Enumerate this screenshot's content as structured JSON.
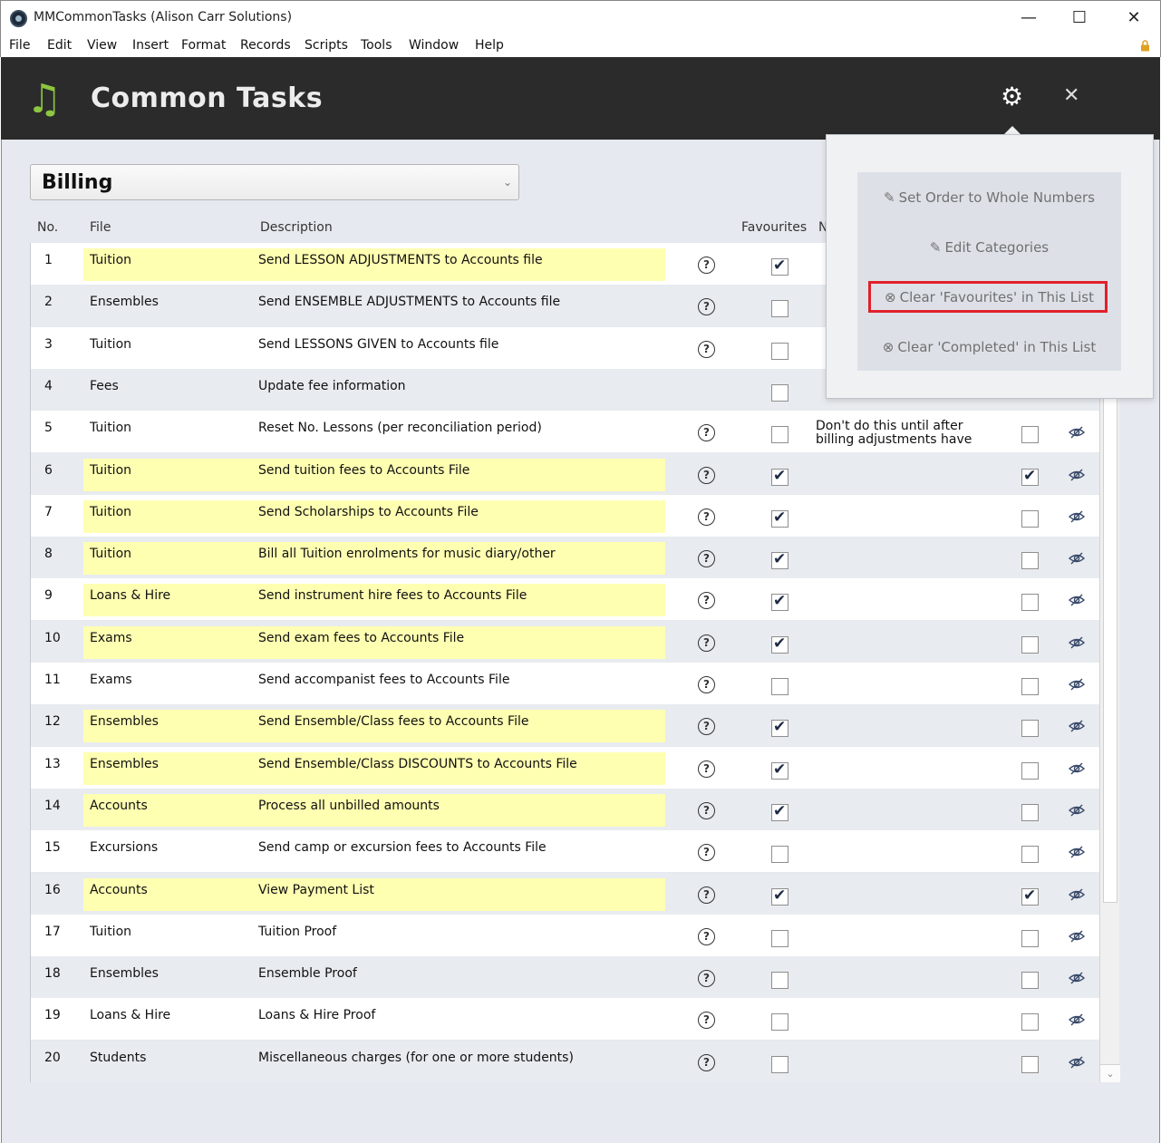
{
  "window": {
    "title": "MMCommonTasks (Alison Carr Solutions)",
    "minimize": "—",
    "maximize": "☐",
    "close": "✕"
  },
  "menu": [
    "File",
    "Edit",
    "View",
    "Insert",
    "Format",
    "Records",
    "Scripts",
    "Tools",
    "Window",
    "Help"
  ],
  "header": {
    "title": "Common Tasks",
    "icon": "music-note-icon",
    "settings_icon": "gear-icon",
    "close_icon": "close-icon"
  },
  "category_select": {
    "value": "Billing"
  },
  "columns": {
    "no": "No.",
    "file": "File",
    "description": "Description",
    "favourites": "Favourites",
    "notes_partial": "N"
  },
  "rows": [
    {
      "no": "1",
      "file": "Tuition",
      "desc": "Send LESSON ADJUSTMENTS to Accounts file",
      "fav": true,
      "hl": true,
      "help": true,
      "note": "",
      "completed": null
    },
    {
      "no": "2",
      "file": "Ensembles",
      "desc": "Send ENSEMBLE ADJUSTMENTS to Accounts file",
      "fav": false,
      "hl": false,
      "help": true,
      "note": "",
      "completed": null
    },
    {
      "no": "3",
      "file": "Tuition",
      "desc": "Send LESSONS GIVEN to Accounts file",
      "fav": false,
      "hl": false,
      "help": true,
      "note": "",
      "completed": null
    },
    {
      "no": "4",
      "file": "Fees",
      "desc": "Update fee information",
      "fav": false,
      "hl": false,
      "help": false,
      "note": "",
      "completed": null
    },
    {
      "no": "5",
      "file": "Tuition",
      "desc": "Reset No. Lessons (per reconciliation period)",
      "fav": false,
      "hl": false,
      "help": true,
      "note": "Don't do this until after billing adjustments have",
      "completed": false
    },
    {
      "no": "6",
      "file": "Tuition",
      "desc": "Send tuition fees to Accounts File",
      "fav": true,
      "hl": true,
      "help": true,
      "note": "",
      "completed": true
    },
    {
      "no": "7",
      "file": "Tuition",
      "desc": "Send Scholarships to Accounts File",
      "fav": true,
      "hl": true,
      "help": true,
      "note": "",
      "completed": false
    },
    {
      "no": "8",
      "file": "Tuition",
      "desc": "Bill all Tuition enrolments for music diary/other",
      "fav": true,
      "hl": true,
      "help": true,
      "note": "",
      "completed": false
    },
    {
      "no": "9",
      "file": "Loans & Hire",
      "desc": "Send instrument hire fees to Accounts File",
      "fav": true,
      "hl": true,
      "help": true,
      "note": "",
      "completed": false
    },
    {
      "no": "10",
      "file": "Exams",
      "desc": "Send exam fees to Accounts File",
      "fav": true,
      "hl": true,
      "help": true,
      "note": "",
      "completed": false
    },
    {
      "no": "11",
      "file": "Exams",
      "desc": "Send accompanist fees to Accounts File",
      "fav": false,
      "hl": false,
      "help": true,
      "note": "",
      "completed": false
    },
    {
      "no": "12",
      "file": "Ensembles",
      "desc": "Send Ensemble/Class fees to Accounts File",
      "fav": true,
      "hl": true,
      "help": true,
      "note": "",
      "completed": false
    },
    {
      "no": "13",
      "file": "Ensembles",
      "desc": "Send Ensemble/Class DISCOUNTS to Accounts File",
      "fav": true,
      "hl": true,
      "help": true,
      "note": "",
      "completed": false
    },
    {
      "no": "14",
      "file": "Accounts",
      "desc": "Process all unbilled amounts",
      "fav": true,
      "hl": true,
      "help": true,
      "note": "",
      "completed": false
    },
    {
      "no": "15",
      "file": "Excursions",
      "desc": "Send camp or excursion fees to Accounts File",
      "fav": false,
      "hl": false,
      "help": true,
      "note": "",
      "completed": false
    },
    {
      "no": "16",
      "file": "Accounts",
      "desc": "View Payment List",
      "fav": true,
      "hl": true,
      "help": true,
      "note": "",
      "completed": true
    },
    {
      "no": "17",
      "file": "Tuition",
      "desc": "Tuition Proof",
      "fav": false,
      "hl": false,
      "help": true,
      "note": "",
      "completed": false
    },
    {
      "no": "18",
      "file": "Ensembles",
      "desc": "Ensemble Proof",
      "fav": false,
      "hl": false,
      "help": true,
      "note": "",
      "completed": false
    },
    {
      "no": "19",
      "file": "Loans & Hire",
      "desc": "Loans & Hire Proof",
      "fav": false,
      "hl": false,
      "help": true,
      "note": "",
      "completed": false
    },
    {
      "no": "20",
      "file": "Students",
      "desc": "Miscellaneous charges (for one or more students)",
      "fav": false,
      "hl": false,
      "help": true,
      "note": "",
      "completed": false
    }
  ],
  "popover": {
    "items": [
      {
        "icon": "pencil-icon",
        "glyph": "✎",
        "label": "Set Order to Whole Numbers"
      },
      {
        "icon": "pencil-icon",
        "glyph": "✎",
        "label": "Edit Categories"
      },
      {
        "icon": "circle-x-icon",
        "glyph": "⊗",
        "label": "Clear 'Favourites' in This List"
      },
      {
        "icon": "circle-x-icon",
        "glyph": "⊗",
        "label": "Clear 'Completed' in This List"
      }
    ]
  },
  "colors": {
    "header_bg": "#2b2b2b",
    "accent_green": "#8dc63f",
    "row_highlight": "#ffffb2",
    "highlight_box": "#e0202a"
  }
}
